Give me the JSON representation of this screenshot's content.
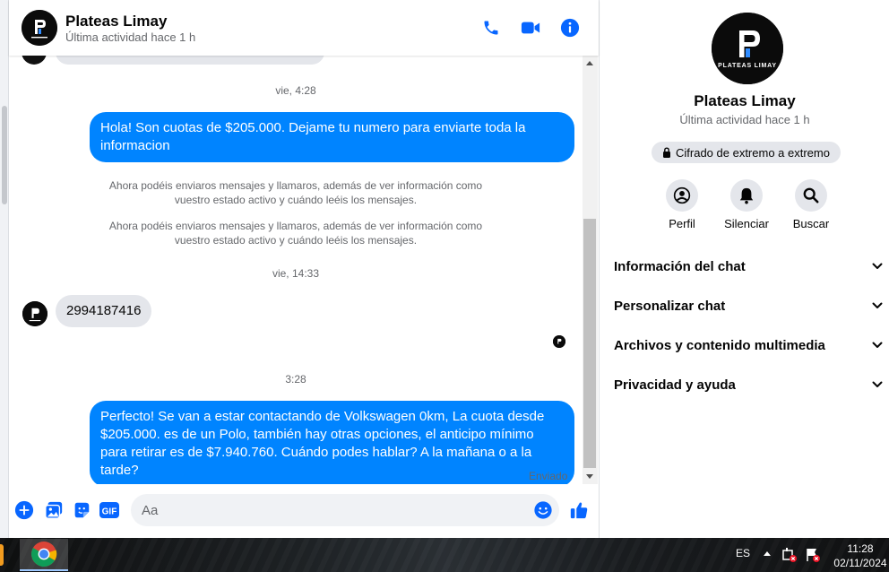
{
  "contact": {
    "name": "Plateas Limay",
    "status": "Última actividad hace 1 h",
    "logo_text": "PLATEAS LIMAY"
  },
  "header_icons": [
    "phone-icon",
    "video-call-icon",
    "info-icon"
  ],
  "messages": {
    "ts1": "vie, 4:28",
    "out1": "Hola! Son cuotas de $205.000. Dejame tu numero para enviarte toda la informacion",
    "sys1": "Ahora podéis enviaros mensajes y llamaros, además de ver información como vuestro estado activo y cuándo leéis los mensajes.",
    "sys2": "Ahora podéis enviaros mensajes y llamaros, además de ver información como vuestro estado activo y cuándo leéis los mensajes.",
    "ts2": "vie, 14:33",
    "in1": "2994187416",
    "ts3": "3:28",
    "out2": "Perfecto!  Se van a estar contactando de Volkswagen 0km, La cuota desde $205.000. es de un Polo, también hay otras opciones, el anticipo mínimo para retirar es de $7.940.760. Cuándo podes hablar? A la mañana o a la tarde?",
    "sent_status": "Enviado"
  },
  "composer": {
    "placeholder": "Aa",
    "icons": [
      "plus-icon",
      "photo-icon",
      "sticker-icon",
      "gif-icon",
      "emoji-icon",
      "like-icon"
    ],
    "gif_label": "GIF"
  },
  "side_panel": {
    "encryption": "Cifrado de extremo a extremo",
    "actions": [
      {
        "label": "Perfil"
      },
      {
        "label": "Silenciar"
      },
      {
        "label": "Buscar"
      }
    ],
    "sections": [
      {
        "label": "Información del chat"
      },
      {
        "label": "Personalizar chat"
      },
      {
        "label": "Archivos y contenido multimedia"
      },
      {
        "label": "Privacidad y ayuda"
      }
    ]
  },
  "taskbar": {
    "language": "ES",
    "time": "11:28",
    "date": "02/11/2024"
  },
  "colors": {
    "accent": "#0084ff",
    "incoming_bubble": "#e4e6eb",
    "icon_blue": "#0866ff"
  }
}
